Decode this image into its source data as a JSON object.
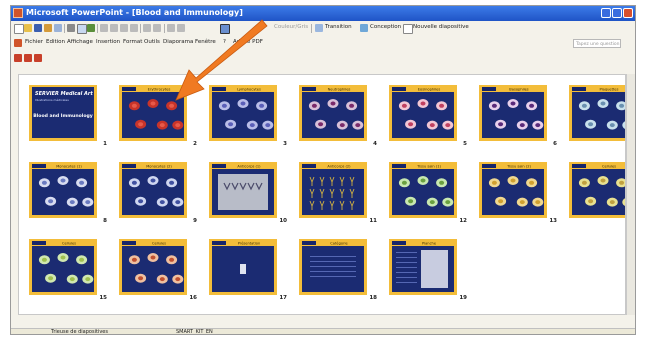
{
  "window": {
    "title": "Microsoft PowerPoint - [Blood and Immunology]"
  },
  "toolbar_standard": {
    "items": [
      "new-icon",
      "open-icon",
      "save-icon",
      "permission-icon",
      "email-icon",
      "print-icon",
      "print-preview-icon",
      "spelling-icon",
      "cut-icon",
      "copy-icon",
      "paste-icon",
      "format-painter-icon",
      "undo-icon",
      "redo-icon",
      "insert-chart-icon",
      "insert-table-icon"
    ],
    "color_grey_label": "Couleur/Gris",
    "transition_label": "Transition",
    "design_label": "Conception",
    "new_slide_label": "Nouvelle diapositive"
  },
  "menu": {
    "items": [
      "Fichier",
      "Edition",
      "Affichage",
      "Insertion",
      "Format",
      "Outils",
      "Diaporama",
      "Fenêtre",
      "?",
      "Adobe PDF"
    ]
  },
  "question_box": {
    "placeholder": "Tapez une question"
  },
  "slides": [
    {
      "num": "1",
      "title": "",
      "kind": "cover",
      "cover_title": "SERVIER Medical Art",
      "cover_sub": "Illustrations médicales",
      "cover_main": "Blood and Immunology"
    },
    {
      "num": "2",
      "title": "Erythrocytes",
      "kind": "rbc"
    },
    {
      "num": "3",
      "title": "Lymphocytes",
      "kind": "lympho"
    },
    {
      "num": "4",
      "title": "Neutrophiles",
      "kind": "neutro"
    },
    {
      "num": "5",
      "title": "Eosinophiles",
      "kind": "eos"
    },
    {
      "num": "6",
      "title": "Basophiles",
      "kind": "baso"
    },
    {
      "num": "7",
      "title": "Plaquettes",
      "kind": "plt"
    },
    {
      "num": "8",
      "title": "Monocytes (1)",
      "kind": "mono1"
    },
    {
      "num": "9",
      "title": "Monocytes (2)",
      "kind": "mono2"
    },
    {
      "num": "10",
      "title": "Anticorps (1)",
      "kind": "ab1"
    },
    {
      "num": "11",
      "title": "Anticorps (2)",
      "kind": "ab2"
    },
    {
      "num": "12",
      "title": "Tissu sain (1)",
      "kind": "tissue1"
    },
    {
      "num": "13",
      "title": "Tissu sain (2)",
      "kind": "tissue2"
    },
    {
      "num": "14",
      "title": "Cellules",
      "kind": "cells14"
    },
    {
      "num": "15",
      "title": "Cellules",
      "kind": "cells15"
    },
    {
      "num": "16",
      "title": "Cellules",
      "kind": "cells16"
    },
    {
      "num": "17",
      "title": "Présentation",
      "kind": "pres"
    },
    {
      "num": "18",
      "title": "Catégorie",
      "kind": "text"
    },
    {
      "num": "19",
      "title": "Planche",
      "kind": "doc"
    }
  ],
  "status": {
    "view": "Trieuse de diapositives",
    "template": "SMART_KIT_EN"
  },
  "colors": {
    "slide_frame": "#f3bd3a",
    "slide_bg": "#1b2b72",
    "arrow": "#f07a22",
    "titlebar": "#2a63d8"
  }
}
